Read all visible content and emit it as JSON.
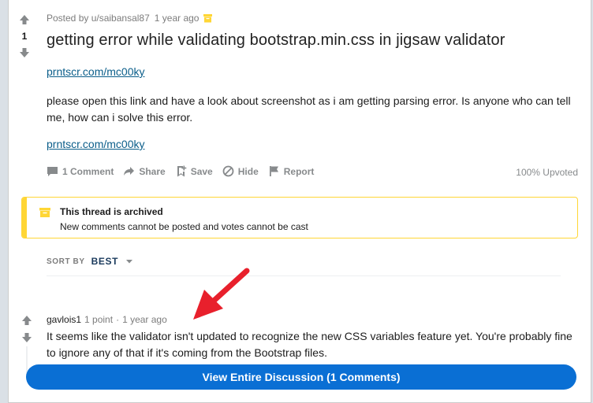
{
  "post": {
    "score": "1",
    "posted_by": "Posted by u/saibansal87",
    "age": "1 year ago",
    "title": "getting error while validating bootstrap.min.css in jigsaw validator",
    "link1": "prntscr.com/mc00ky",
    "body": "please open this link and have a look about screenshot as i am getting parsing error. Is anyone who can tell me, how can i solve this error.",
    "link2": "prntscr.com/mc00ky",
    "actions": {
      "comments": "1 Comment",
      "share": "Share",
      "save": "Save",
      "hide": "Hide",
      "report": "Report"
    },
    "upvoted": "100% Upvoted"
  },
  "archived": {
    "heading": "This thread is archived",
    "text": "New comments cannot be posted and votes cannot be cast"
  },
  "sort": {
    "label": "SORT BY",
    "value": "BEST"
  },
  "comment": {
    "user": "gavlois1",
    "points": "1 point",
    "separator": "·",
    "age": "1 year ago",
    "text": "It seems like the validator isn't updated to recognize the new CSS variables feature yet. You're probably fine to ignore any of that if it's coming from the Bootstrap files."
  },
  "view_button": "View Entire Discussion (1 Comments)",
  "colors": {
    "accent": "#0a6fd4",
    "archive": "#ffd635",
    "annotation_arrow": "#e8202c"
  }
}
